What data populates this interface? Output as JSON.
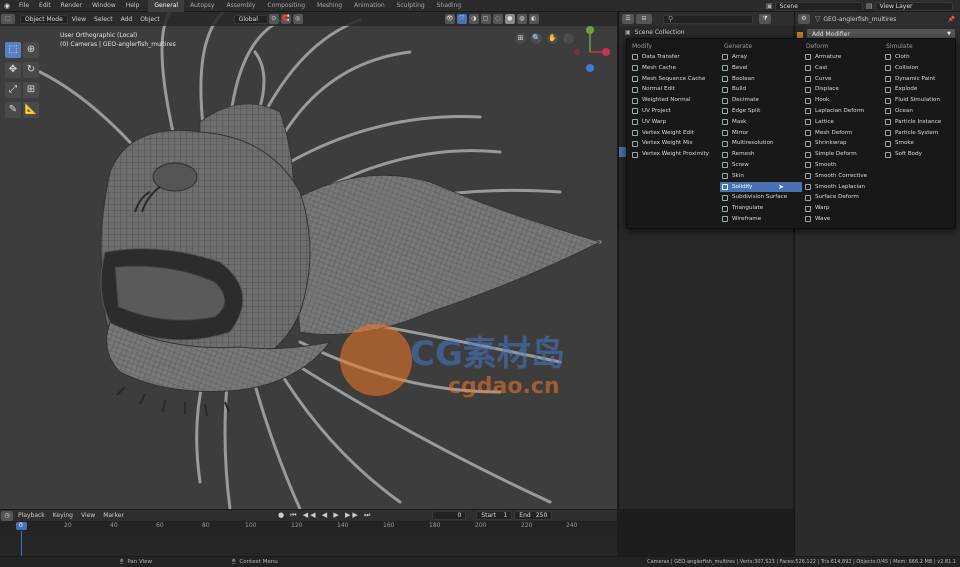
{
  "topbar": {
    "menus": [
      "File",
      "Edit",
      "Render",
      "Window",
      "Help"
    ],
    "workspaces": [
      "General",
      "Autopsy",
      "Assembly",
      "Compositing",
      "Meshing",
      "Animation",
      "Sculpting",
      "Shading"
    ],
    "active_workspace": "General",
    "scene": "Scene",
    "view_layer": "View Layer"
  },
  "viewport": {
    "mode": "Object Mode",
    "menus": [
      "View",
      "Select",
      "Add",
      "Object"
    ],
    "orientation": "Global",
    "view_name": "User Orthographic (Local)",
    "view_object": "(0) Cameras | GEO-anglerfish_multires"
  },
  "watermark": {
    "brand": "CG素材岛",
    "domain": "cgdao.cn"
  },
  "timeline": {
    "menus": [
      "Playback",
      "Keying",
      "View",
      "Marker"
    ],
    "current_frame": "0",
    "start_label": "Start",
    "start": "1",
    "end_label": "End",
    "end": "250",
    "ruler": [
      "0",
      "20",
      "40",
      "60",
      "80",
      "100",
      "120",
      "140",
      "160",
      "180",
      "200",
      "220",
      "240"
    ]
  },
  "outliner": {
    "scene_collection": "Scene Collection"
  },
  "properties": {
    "object_name": "GEO-anglerfish_multires",
    "add_modifier": "Add Modifier"
  },
  "modifier_menu": {
    "columns": [
      {
        "title": "Modify",
        "items": [
          "Data Transfer",
          "Mesh Cache",
          "Mesh Sequence Cache",
          "Normal Edit",
          "Weighted Normal",
          "UV Project",
          "UV Warp",
          "Vertex Weight Edit",
          "Vertex Weight Mix",
          "Vertex Weight Proximity"
        ]
      },
      {
        "title": "Generate",
        "items": [
          "Array",
          "Bevel",
          "Boolean",
          "Build",
          "Decimate",
          "Edge Split",
          "Mask",
          "Mirror",
          "Multiresolution",
          "Remesh",
          "Screw",
          "Skin",
          "Solidify",
          "Subdivision Surface",
          "Triangulate",
          "Wireframe"
        ]
      },
      {
        "title": "Deform",
        "items": [
          "Armature",
          "Cast",
          "Curve",
          "Displace",
          "Hook",
          "Laplacian Deform",
          "Lattice",
          "Mesh Deform",
          "Shrinkwrap",
          "Simple Deform",
          "Smooth",
          "Smooth Corrective",
          "Smooth Laplacian",
          "Surface Deform",
          "Warp",
          "Wave"
        ]
      },
      {
        "title": "Simulate",
        "items": [
          "Cloth",
          "Collision",
          "Dynamic Paint",
          "Explode",
          "Fluid Simulation",
          "Ocean",
          "Particle Instance",
          "Particle System",
          "Smoke",
          "Soft Body"
        ]
      }
    ],
    "highlighted": "Solidify"
  },
  "status": {
    "left_hint": "Pan View",
    "right_hint": "Context Menu",
    "stats": "Cameras | GEO-anglerfish_multires | Verts:307,523 | Faces:526,122 | Tris:614,892 | Objects:0/45 | Mem: 666.2 MB | v2.81.1"
  },
  "colors": {
    "accent": "#4772b3",
    "bg": "#3d3d3d"
  }
}
